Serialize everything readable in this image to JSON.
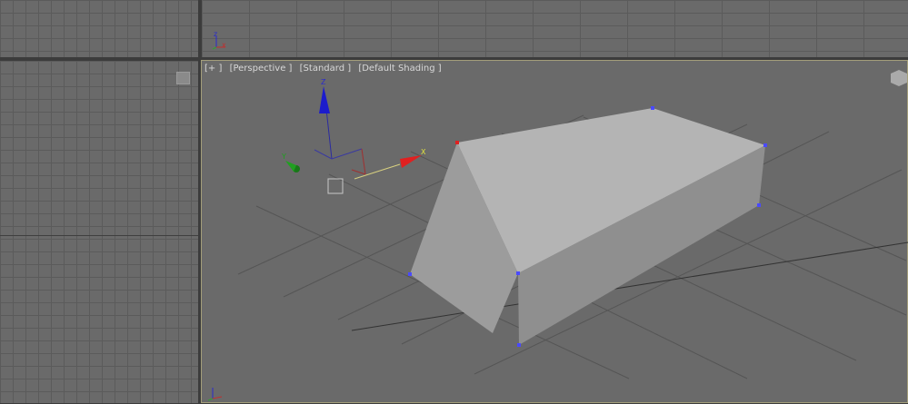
{
  "viewports": {
    "perspective": {
      "plus": "[+ ]",
      "view": "[Perspective ]",
      "mode": "[Standard ]",
      "shading": "[Default Shading ]"
    },
    "gizmo_axes": {
      "x": "X",
      "y": "Y",
      "z": "Z"
    }
  },
  "colors": {
    "x_axis": "#e02020",
    "y_axis": "#20a020",
    "z_axis": "#1c1ccc",
    "active_border": "#a39e7a",
    "vertex": "#4a4aff",
    "selected_vertex": "#e02020"
  }
}
